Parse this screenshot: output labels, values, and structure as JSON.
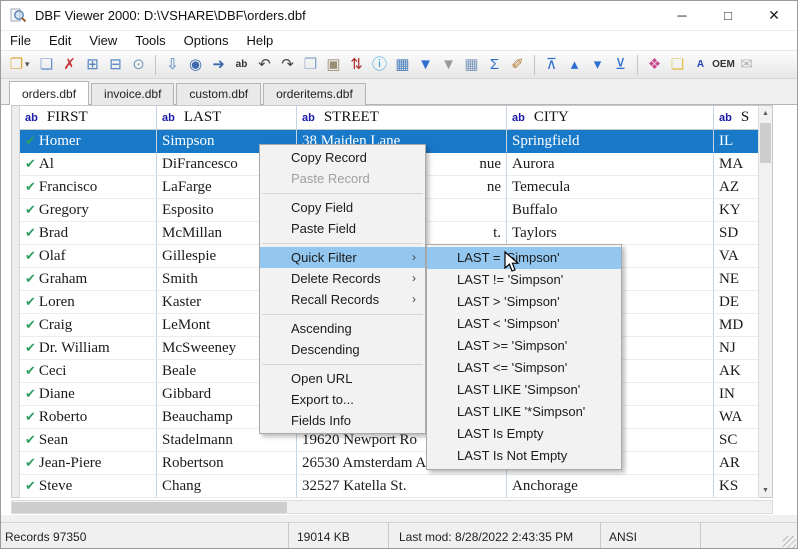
{
  "window": {
    "title": "DBF Viewer 2000: D:\\VSHARE\\DBF\\orders.dbf",
    "controls": {
      "minimize": "─",
      "maximize": "□",
      "close": "✕"
    }
  },
  "menu_bar": {
    "items": [
      "File",
      "Edit",
      "View",
      "Tools",
      "Options",
      "Help"
    ]
  },
  "toolbar": {
    "items": [
      {
        "name": "open-icon",
        "glyph": "❐",
        "color": "#dca73e"
      },
      {
        "name": "open-dropdown-caret",
        "glyph": "▾",
        "color": "#555",
        "caret": true
      },
      {
        "name": "new-file-icon",
        "glyph": "❏",
        "color": "#6b93c9"
      },
      {
        "name": "delete-record-icon",
        "glyph": "✗",
        "color": "#c93232"
      },
      {
        "name": "structure-export-icon",
        "glyph": "⊞",
        "color": "#4a7ebb"
      },
      {
        "name": "field-structure-icon",
        "glyph": "⊟",
        "color": "#4a7ebb"
      },
      {
        "name": "zoom-icon",
        "glyph": "⊙",
        "color": "#7d98bb"
      },
      {
        "separator": true
      },
      {
        "name": "save-icon",
        "glyph": "⇩",
        "color": "#4a7ebb"
      },
      {
        "name": "find-icon",
        "glyph": "◉",
        "color": "#3f6cae"
      },
      {
        "name": "find-next-icon",
        "glyph": "➜",
        "color": "#3f6cae"
      },
      {
        "name": "replace-icon",
        "glyph": "ab",
        "color": "#333333",
        "text": true
      },
      {
        "name": "undo-icon",
        "glyph": "↶",
        "color": "#444444"
      },
      {
        "name": "redo-icon",
        "glyph": "↷",
        "color": "#444444"
      },
      {
        "name": "copy-icon",
        "glyph": "❒",
        "color": "#8aa5c8"
      },
      {
        "name": "paste-icon",
        "glyph": "▣",
        "color": "#9a8f74"
      },
      {
        "name": "sort-az-icon",
        "glyph": "⇅",
        "color": "#b03030"
      },
      {
        "name": "info-bubble-icon",
        "glyph": "ⓘ",
        "color": "#2d9fe0"
      },
      {
        "name": "filter-table-icon",
        "glyph": "▦",
        "color": "#4a7ebb"
      },
      {
        "name": "filter-icon",
        "glyph": "▼",
        "color": "#2e6fd0"
      },
      {
        "name": "clear-filter-icon",
        "glyph": "▼",
        "color": "#9a9a9a"
      },
      {
        "name": "grid-icon",
        "glyph": "▦",
        "color": "#7d98bb"
      },
      {
        "name": "sum-icon",
        "glyph": "Σ",
        "color": "#2e6fd0"
      },
      {
        "name": "brush-icon",
        "glyph": "✐",
        "color": "#b0762e"
      },
      {
        "separator": true
      },
      {
        "name": "first-record-icon",
        "glyph": "⊼",
        "color": "#2e6fd0"
      },
      {
        "name": "prior-record-icon",
        "glyph": "▴",
        "color": "#2e6fd0"
      },
      {
        "name": "next-record-icon",
        "glyph": "▾",
        "color": "#2e6fd0"
      },
      {
        "name": "last-record-icon",
        "glyph": "⊻",
        "color": "#2e6fd0"
      },
      {
        "separator": true
      },
      {
        "name": "color-palette-icon",
        "glyph": "❖",
        "color": "#c94b8f"
      },
      {
        "name": "layers-icon",
        "glyph": "❏",
        "color": "#e0c050"
      },
      {
        "name": "font-icon",
        "glyph": "A",
        "color": "#2244bb",
        "text": true
      },
      {
        "name": "oem-icon",
        "glyph": "OEM",
        "color": "#333333",
        "text": true
      },
      {
        "name": "export-mail-icon",
        "glyph": "✉",
        "color": "#b5b5b5"
      }
    ]
  },
  "tab_bar": {
    "active_index": 0,
    "tabs": [
      "orders.dbf",
      "invoice.dbf",
      "custom.dbf",
      "orderitems.dbf"
    ]
  },
  "table": {
    "row_check_icon": "✔",
    "columns": [
      {
        "key": "first",
        "type_prefix": "ab",
        "label": "FIRST"
      },
      {
        "key": "last",
        "type_prefix": "ab",
        "label": "LAST"
      },
      {
        "key": "street",
        "type_prefix": "ab",
        "label": "STREET"
      },
      {
        "key": "city",
        "type_prefix": "ab",
        "label": "CITY"
      },
      {
        "key": "state",
        "type_prefix": "ab",
        "label": "S"
      }
    ],
    "rows": [
      {
        "selected": true,
        "first": "Homer",
        "last": "Simpson",
        "street": "38 Maiden Lane",
        "city": "Springfield",
        "state": "IL"
      },
      {
        "first": "Al",
        "last": "DiFrancesco",
        "street": "nue",
        "street_partial": true,
        "city": "Aurora",
        "state": "MA"
      },
      {
        "first": "Francisco",
        "last": "LaFarge",
        "street": "ne",
        "street_partial": true,
        "city": "Temecula",
        "state": "AZ"
      },
      {
        "first": "Gregory",
        "last": "Esposito",
        "street": "",
        "city": "Buffalo",
        "state": "KY"
      },
      {
        "first": "Brad",
        "last": "McMillan",
        "street": "t.",
        "street_partial": true,
        "city": "Taylors",
        "state": "SD"
      },
      {
        "first": "Olaf",
        "last": "Gillespie",
        "street": "",
        "city": "",
        "state": "VA"
      },
      {
        "first": "Graham",
        "last": "Smith",
        "street": "",
        "city": "",
        "state": "NE"
      },
      {
        "first": "Loren",
        "last": "Kaster",
        "street": "",
        "city": "",
        "state": "DE"
      },
      {
        "first": "Craig",
        "last": "LeMont",
        "street": "",
        "city": "",
        "state": "MD"
      },
      {
        "first": "Dr. William",
        "last": "McSweeney",
        "street": "",
        "city": "",
        "state": "NJ"
      },
      {
        "first": "Ceci",
        "last": "Beale",
        "street": "",
        "city": "",
        "state": "AK"
      },
      {
        "first": "Diane",
        "last": "Gibbard",
        "street": "",
        "city": "",
        "state": "IN"
      },
      {
        "first": "Roberto",
        "last": "Beauchamp",
        "street": "",
        "city": "",
        "state": "WA"
      },
      {
        "first": "Sean",
        "last": "Stadelmann",
        "street": "19620 Newport Ro",
        "city": "",
        "state": "SC"
      },
      {
        "first": "Jean-Piere",
        "last": "Robertson",
        "street": "26530 Amsterdam A",
        "city": "",
        "state": "AR"
      },
      {
        "first": "Steve",
        "last": "Chang",
        "street": "32527 Katella St.",
        "city": "Anchorage",
        "state": "KS"
      }
    ]
  },
  "context_menu": {
    "submenu_arrow": "›",
    "items": [
      {
        "label": "Copy Record"
      },
      {
        "label": "Paste Record",
        "disabled": true
      },
      {
        "separator": true
      },
      {
        "label": "Copy Field"
      },
      {
        "label": "Paste Field"
      },
      {
        "separator": true
      },
      {
        "label": "Quick Filter",
        "submenu": true,
        "highlighted": true
      },
      {
        "label": "Delete Records",
        "submenu": true
      },
      {
        "label": "Recall Records",
        "submenu": true
      },
      {
        "separator": true
      },
      {
        "label": "Ascending"
      },
      {
        "label": "Descending"
      },
      {
        "separator": true
      },
      {
        "label": "Open URL"
      },
      {
        "label": "Export to..."
      },
      {
        "label": "Fields Info"
      }
    ]
  },
  "quick_filter_submenu": {
    "items": [
      {
        "label": "LAST = 'Simpson'",
        "highlighted": true
      },
      {
        "label": "LAST != 'Simpson'"
      },
      {
        "label": "LAST > 'Simpson'"
      },
      {
        "label": "LAST < 'Simpson'"
      },
      {
        "label": "LAST >= 'Simpson'"
      },
      {
        "label": "LAST <= 'Simpson'"
      },
      {
        "label": "LAST LIKE 'Simpson'"
      },
      {
        "label": "LAST LIKE '*Simpson'"
      },
      {
        "label": "LAST Is Empty"
      },
      {
        "label": "LAST Is Not Empty"
      }
    ]
  },
  "scrollbars": {
    "up_arrow": "▲",
    "down_arrow": "▼"
  },
  "status_bar": {
    "records": "Records 97350",
    "size": "19014 KB",
    "last_mod": "Last mod: 8/28/2022 2:43:35 PM",
    "encoding": "ANSI"
  },
  "colors": {
    "selection": "#1779c8",
    "menu_highlight": "#93c7ef",
    "check_green": "#2f9e60",
    "type_prefix": "#1a1aa6"
  }
}
